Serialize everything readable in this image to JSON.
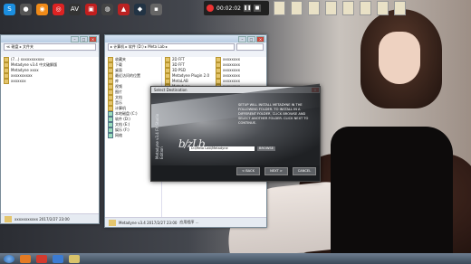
{
  "topbar": {
    "icons": [
      {
        "name": "s-app-icon",
        "glyph": "S",
        "color": "#1b8ee0"
      },
      {
        "name": "sphere-icon",
        "glyph": "●",
        "color": "#555"
      },
      {
        "name": "orange-app-icon",
        "glyph": "◉",
        "color": "#f08a18"
      },
      {
        "name": "red-circle-app-icon",
        "glyph": "◎",
        "color": "#d22"
      },
      {
        "name": "av-icon",
        "glyph": "AV",
        "color": "#333"
      },
      {
        "name": "red-app-icon",
        "glyph": "▣",
        "color": "#c21e1e"
      },
      {
        "name": "orb-icon",
        "glyph": "◍",
        "color": "#444"
      },
      {
        "name": "red-triangle-icon",
        "glyph": "▲",
        "color": "#b22"
      },
      {
        "name": "3d-app-icon",
        "glyph": "◆",
        "color": "#234"
      },
      {
        "name": "grey-app-icon",
        "glyph": "▪",
        "color": "#666"
      }
    ],
    "recorder_time": "00:02:02"
  },
  "colors": {
    "accent": "#2a5ea8",
    "dialog_bg": "#1b1d20"
  },
  "left_window": {
    "address": "≪ 磁盘 ▸ 文件夹",
    "items": [
      "(7...) xxxxxxxxxxx",
      "Metadyne v3.4 中文破解版",
      "Metadyne xxxx",
      "xxxxxxxxxx",
      "xxxxxxx"
    ],
    "nav_items": [
      "收藏夹",
      "下载",
      "桌面",
      "最近访问的位置",
      "库",
      "视频",
      "图片",
      "文档",
      "音乐",
      "计算机",
      "本地磁盘 (C:)",
      "软件 (D:)",
      "文档 (E:)",
      "娱乐 (F:)"
    ],
    "status": "xxxxxxxxxxx  2017/2/27 23:00"
  },
  "right_window": {
    "address": "▸ 计算机 ▸ 软件 (D:) ▸ Meta Lab ▸",
    "nav_items": [
      "收藏夹",
      "下载",
      "桌面",
      "最近访问的位置",
      "库",
      "视频",
      "图片",
      "文档",
      "音乐",
      "计算机",
      "本地磁盘 (C:)",
      "软件 (D:)",
      "文档 (E:)",
      "娱乐 (F:)",
      "网络"
    ],
    "files": [
      "2D FFT",
      "3D FFT",
      "3D PSD",
      "Metadyne Plugin 2.0",
      "MetaLAB",
      "Metadyne",
      "Mastered Dock Sc...",
      "Mastered Plug-1",
      "Meta Lab",
      "xxxxxxx",
      "xxxxxxx",
      "xxxxxxx",
      "xxxxxxx",
      "xxxxxxx"
    ],
    "files_right": [
      "xxxxxxxx",
      "xxxxxxxx",
      "xxxxxxxx",
      "xxxxxxxx",
      "xxxxxxxx",
      "xxxxxxxx",
      "xxxxxxxx",
      "xxxxxxxx",
      "xxxxxxxx",
      "xxxxxxxx",
      "xxxxxxxx",
      "xxxxxxxx",
      "xxxxxxxx",
      "xxxxxxxx"
    ],
    "status_name": "Metadyne v3.4  2017/2/27 23:00",
    "status_detail": "应用程序  ..."
  },
  "dialog": {
    "title": "Select Destination",
    "brand_vertical": "Metadyne v3.4 FX Studio Edition",
    "description": "SETUP WILL INSTALL METADYNE IN THE FOLLOWING FOLDER. TO INSTALL IN A DIFFERENT FOLDER, CLICK BROWSE AND SELECT ANOTHER FOLDER. CLICK NEXT TO CONTINUE.",
    "logo": "b/zLb",
    "path": "D:\\Meta Lab\\Metadyne",
    "browse": "BROWSE",
    "buttons": [
      "< BACK",
      "NEXT >",
      "CANCEL"
    ],
    "close": "×"
  }
}
